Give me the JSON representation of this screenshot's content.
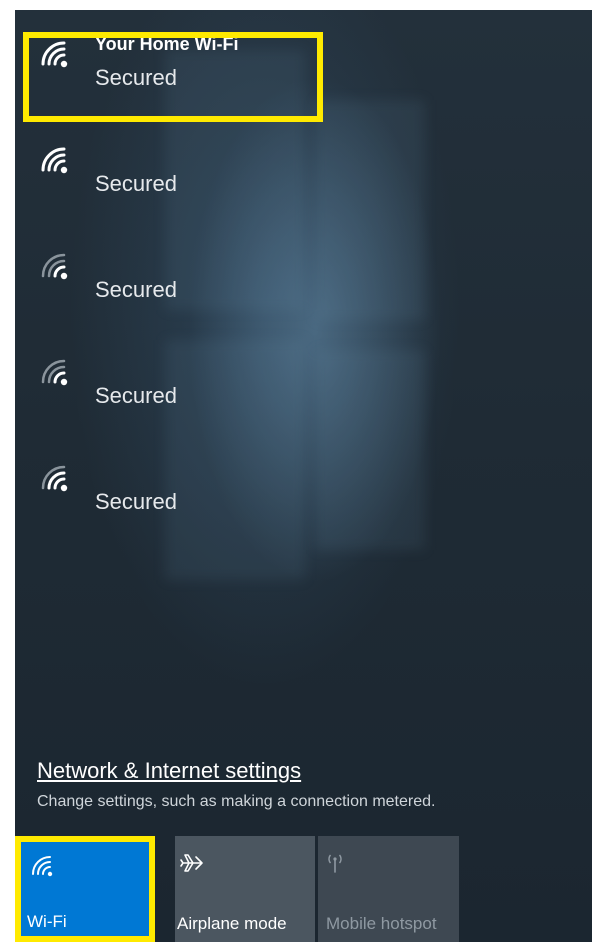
{
  "networks": [
    {
      "name": "Your Home Wi-Fi",
      "status": "Secured",
      "icon": "wifi-signal-icon",
      "highlighted": true
    },
    {
      "name": "",
      "status": "Secured",
      "icon": "wifi-signal-icon"
    },
    {
      "name": "",
      "status": "Secured",
      "icon": "wifi-signal-icon"
    },
    {
      "name": "",
      "status": "Secured",
      "icon": "wifi-signal-icon"
    },
    {
      "name": "",
      "status": "Secured",
      "icon": "wifi-signal-icon"
    }
  ],
  "settings": {
    "link_label": "Network & Internet settings",
    "description": "Change settings, such as making a connection metered."
  },
  "quick_actions": {
    "wifi": {
      "label": "Wi-Fi",
      "icon": "wifi-icon",
      "state": "on"
    },
    "airplane": {
      "label": "Airplane mode",
      "icon": "airplane-icon",
      "state": "off"
    },
    "hotspot": {
      "label": "Mobile hotspot",
      "icon": "hotspot-icon",
      "state": "disabled"
    }
  },
  "colors": {
    "accent": "#0078d4",
    "highlight": "#ffea00",
    "background": "#1f2b35"
  }
}
